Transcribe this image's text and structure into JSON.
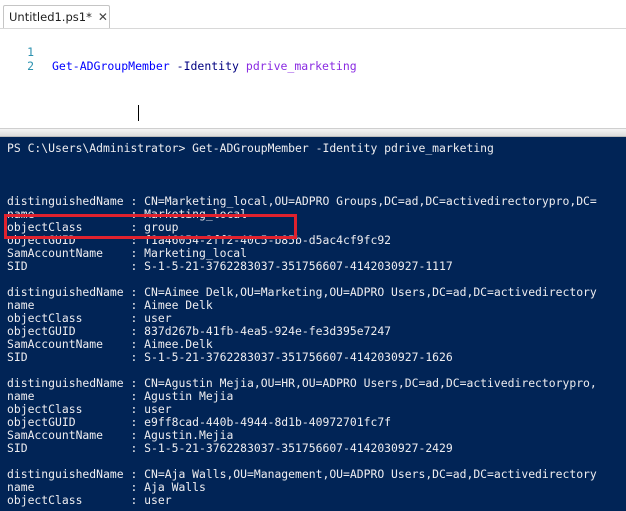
{
  "tab": {
    "title": "Untitled1.ps1*",
    "close": "✕"
  },
  "editor": {
    "line_numbers": [
      "1",
      "2"
    ],
    "line1": {
      "command": "Get-ADGroupMember",
      "parameter": "-Identity",
      "argument": "pdrive_marketing"
    }
  },
  "console": {
    "prompt": "PS C:\\Users\\Administrator> Get-ADGroupMember -Identity pdrive_marketing",
    "lines": [
      "distinguishedName : CN=Marketing_local,OU=ADPRO Groups,DC=ad,DC=activedirectorypro,DC=",
      "name              : Marketing_local",
      "objectClass       : group",
      "objectGUID        : f1a46054-2ff2-40c5-b85b-d5ac4cf9fc92",
      "SamAccountName    : Marketing_local",
      "SID               : S-1-5-21-3762283037-351756607-4142030927-1117",
      "distinguishedName : CN=Aimee Delk,OU=Marketing,OU=ADPRO Users,DC=ad,DC=activedirectory",
      "name              : Aimee Delk",
      "objectClass       : user",
      "objectGUID        : 837d267b-41fb-4ea5-924e-fe3d395e7247",
      "SamAccountName    : Aimee.Delk",
      "SID               : S-1-5-21-3762283037-351756607-4142030927-1626",
      "distinguishedName : CN=Agustin Mejia,OU=HR,OU=ADPRO Users,DC=ad,DC=activedirectorypro,",
      "name              : Agustin Mejia",
      "objectClass       : user",
      "objectGUID        : e9ff8cad-440b-4944-8d1b-40972701fc7f",
      "SamAccountName    : Agustin.Mejia",
      "SID               : S-1-5-21-3762283037-351756607-4142030927-2429",
      "distinguishedName : CN=Aja Walls,OU=Management,OU=ADPRO Users,DC=ad,DC=activedirectory",
      "name              : Aja Walls",
      "objectClass       : user"
    ]
  },
  "colors": {
    "console_bg": "#012456",
    "console_text": "#eeedf0",
    "highlight": "#e0222e",
    "cmdlet": "#0000ff",
    "parameter": "#000080",
    "argument": "#8a2be2"
  }
}
